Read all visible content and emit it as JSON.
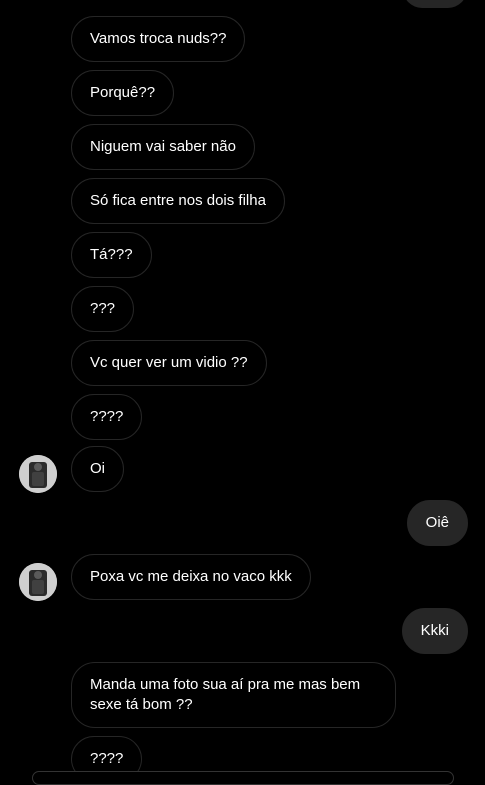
{
  "thread": {
    "messages": [
      {
        "from": "them",
        "text": "Vamos troca nuds??"
      },
      {
        "from": "them",
        "text": "Porquê??"
      },
      {
        "from": "them",
        "text": "Niguem vai saber não"
      },
      {
        "from": "them",
        "text": "Só fica entre nos dois filha"
      },
      {
        "from": "them",
        "text": "Tá???"
      },
      {
        "from": "them",
        "text": "???"
      },
      {
        "from": "them",
        "text": "Vc quer ver um vidio ??"
      },
      {
        "from": "them",
        "text": "????"
      },
      {
        "from": "them",
        "text": "Oi"
      },
      {
        "from": "me",
        "text": "Oiê"
      },
      {
        "from": "them",
        "text": "Poxa vc me deixa no vaco kkk"
      },
      {
        "from": "me",
        "text": "Kkki"
      },
      {
        "from": "them",
        "text": "Manda uma foto sua aí pra me mas bem\nsexe tá bom ??"
      },
      {
        "from": "them",
        "text": "????"
      }
    ]
  },
  "colors": {
    "background": "#000000",
    "received_bubble_border": "#262626",
    "sent_bubble_fill": "#262626",
    "text": "#ffffff"
  },
  "icons": {
    "avatar": "profile-photo-icon"
  }
}
